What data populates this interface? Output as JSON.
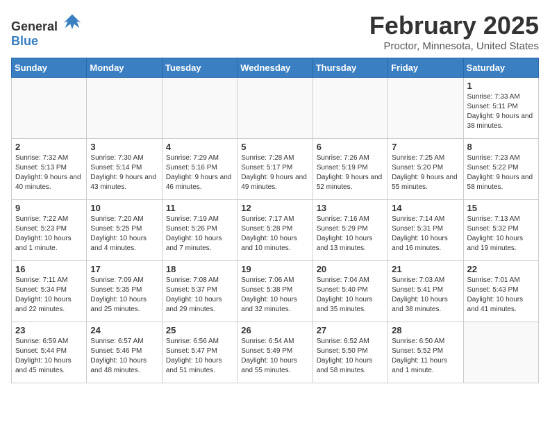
{
  "header": {
    "logo_general": "General",
    "logo_blue": "Blue",
    "title": "February 2025",
    "subtitle": "Proctor, Minnesota, United States"
  },
  "days_of_week": [
    "Sunday",
    "Monday",
    "Tuesday",
    "Wednesday",
    "Thursday",
    "Friday",
    "Saturday"
  ],
  "weeks": [
    [
      {
        "day": "",
        "info": "",
        "empty": true
      },
      {
        "day": "",
        "info": "",
        "empty": true
      },
      {
        "day": "",
        "info": "",
        "empty": true
      },
      {
        "day": "",
        "info": "",
        "empty": true
      },
      {
        "day": "",
        "info": "",
        "empty": true
      },
      {
        "day": "",
        "info": "",
        "empty": true
      },
      {
        "day": "1",
        "info": "Sunrise: 7:33 AM\nSunset: 5:11 PM\nDaylight: 9 hours and 38 minutes.",
        "empty": false
      }
    ],
    [
      {
        "day": "2",
        "info": "Sunrise: 7:32 AM\nSunset: 5:13 PM\nDaylight: 9 hours and 40 minutes.",
        "empty": false
      },
      {
        "day": "3",
        "info": "Sunrise: 7:30 AM\nSunset: 5:14 PM\nDaylight: 9 hours and 43 minutes.",
        "empty": false
      },
      {
        "day": "4",
        "info": "Sunrise: 7:29 AM\nSunset: 5:16 PM\nDaylight: 9 hours and 46 minutes.",
        "empty": false
      },
      {
        "day": "5",
        "info": "Sunrise: 7:28 AM\nSunset: 5:17 PM\nDaylight: 9 hours and 49 minutes.",
        "empty": false
      },
      {
        "day": "6",
        "info": "Sunrise: 7:26 AM\nSunset: 5:19 PM\nDaylight: 9 hours and 52 minutes.",
        "empty": false
      },
      {
        "day": "7",
        "info": "Sunrise: 7:25 AM\nSunset: 5:20 PM\nDaylight: 9 hours and 55 minutes.",
        "empty": false
      },
      {
        "day": "8",
        "info": "Sunrise: 7:23 AM\nSunset: 5:22 PM\nDaylight: 9 hours and 58 minutes.",
        "empty": false
      }
    ],
    [
      {
        "day": "9",
        "info": "Sunrise: 7:22 AM\nSunset: 5:23 PM\nDaylight: 10 hours and 1 minute.",
        "empty": false
      },
      {
        "day": "10",
        "info": "Sunrise: 7:20 AM\nSunset: 5:25 PM\nDaylight: 10 hours and 4 minutes.",
        "empty": false
      },
      {
        "day": "11",
        "info": "Sunrise: 7:19 AM\nSunset: 5:26 PM\nDaylight: 10 hours and 7 minutes.",
        "empty": false
      },
      {
        "day": "12",
        "info": "Sunrise: 7:17 AM\nSunset: 5:28 PM\nDaylight: 10 hours and 10 minutes.",
        "empty": false
      },
      {
        "day": "13",
        "info": "Sunrise: 7:16 AM\nSunset: 5:29 PM\nDaylight: 10 hours and 13 minutes.",
        "empty": false
      },
      {
        "day": "14",
        "info": "Sunrise: 7:14 AM\nSunset: 5:31 PM\nDaylight: 10 hours and 16 minutes.",
        "empty": false
      },
      {
        "day": "15",
        "info": "Sunrise: 7:13 AM\nSunset: 5:32 PM\nDaylight: 10 hours and 19 minutes.",
        "empty": false
      }
    ],
    [
      {
        "day": "16",
        "info": "Sunrise: 7:11 AM\nSunset: 5:34 PM\nDaylight: 10 hours and 22 minutes.",
        "empty": false
      },
      {
        "day": "17",
        "info": "Sunrise: 7:09 AM\nSunset: 5:35 PM\nDaylight: 10 hours and 25 minutes.",
        "empty": false
      },
      {
        "day": "18",
        "info": "Sunrise: 7:08 AM\nSunset: 5:37 PM\nDaylight: 10 hours and 29 minutes.",
        "empty": false
      },
      {
        "day": "19",
        "info": "Sunrise: 7:06 AM\nSunset: 5:38 PM\nDaylight: 10 hours and 32 minutes.",
        "empty": false
      },
      {
        "day": "20",
        "info": "Sunrise: 7:04 AM\nSunset: 5:40 PM\nDaylight: 10 hours and 35 minutes.",
        "empty": false
      },
      {
        "day": "21",
        "info": "Sunrise: 7:03 AM\nSunset: 5:41 PM\nDaylight: 10 hours and 38 minutes.",
        "empty": false
      },
      {
        "day": "22",
        "info": "Sunrise: 7:01 AM\nSunset: 5:43 PM\nDaylight: 10 hours and 41 minutes.",
        "empty": false
      }
    ],
    [
      {
        "day": "23",
        "info": "Sunrise: 6:59 AM\nSunset: 5:44 PM\nDaylight: 10 hours and 45 minutes.",
        "empty": false
      },
      {
        "day": "24",
        "info": "Sunrise: 6:57 AM\nSunset: 5:46 PM\nDaylight: 10 hours and 48 minutes.",
        "empty": false
      },
      {
        "day": "25",
        "info": "Sunrise: 6:56 AM\nSunset: 5:47 PM\nDaylight: 10 hours and 51 minutes.",
        "empty": false
      },
      {
        "day": "26",
        "info": "Sunrise: 6:54 AM\nSunset: 5:49 PM\nDaylight: 10 hours and 55 minutes.",
        "empty": false
      },
      {
        "day": "27",
        "info": "Sunrise: 6:52 AM\nSunset: 5:50 PM\nDaylight: 10 hours and 58 minutes.",
        "empty": false
      },
      {
        "day": "28",
        "info": "Sunrise: 6:50 AM\nSunset: 5:52 PM\nDaylight: 11 hours and 1 minute.",
        "empty": false
      },
      {
        "day": "",
        "info": "",
        "empty": true
      }
    ]
  ]
}
